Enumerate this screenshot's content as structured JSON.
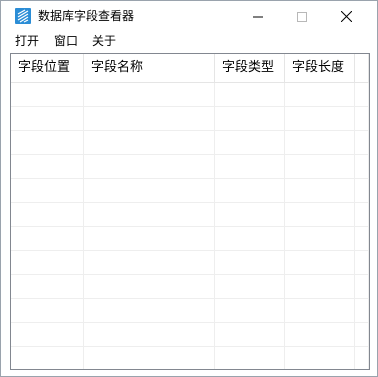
{
  "window": {
    "title": "数据库字段查看器",
    "icon": "database-app-icon",
    "controls": [
      "minimize-icon",
      "maximize-icon",
      "close-icon"
    ]
  },
  "menu": {
    "items": [
      {
        "label": "打开"
      },
      {
        "label": "窗口"
      },
      {
        "label": "关于"
      }
    ]
  },
  "table": {
    "columns": [
      {
        "label": "字段位置"
      },
      {
        "label": "字段名称"
      },
      {
        "label": "字段类型"
      },
      {
        "label": "字段长度"
      }
    ],
    "rows": []
  },
  "colors": {
    "accent": "#2b8dd6",
    "grid_line": "#eeeeee",
    "border": "#828790"
  }
}
